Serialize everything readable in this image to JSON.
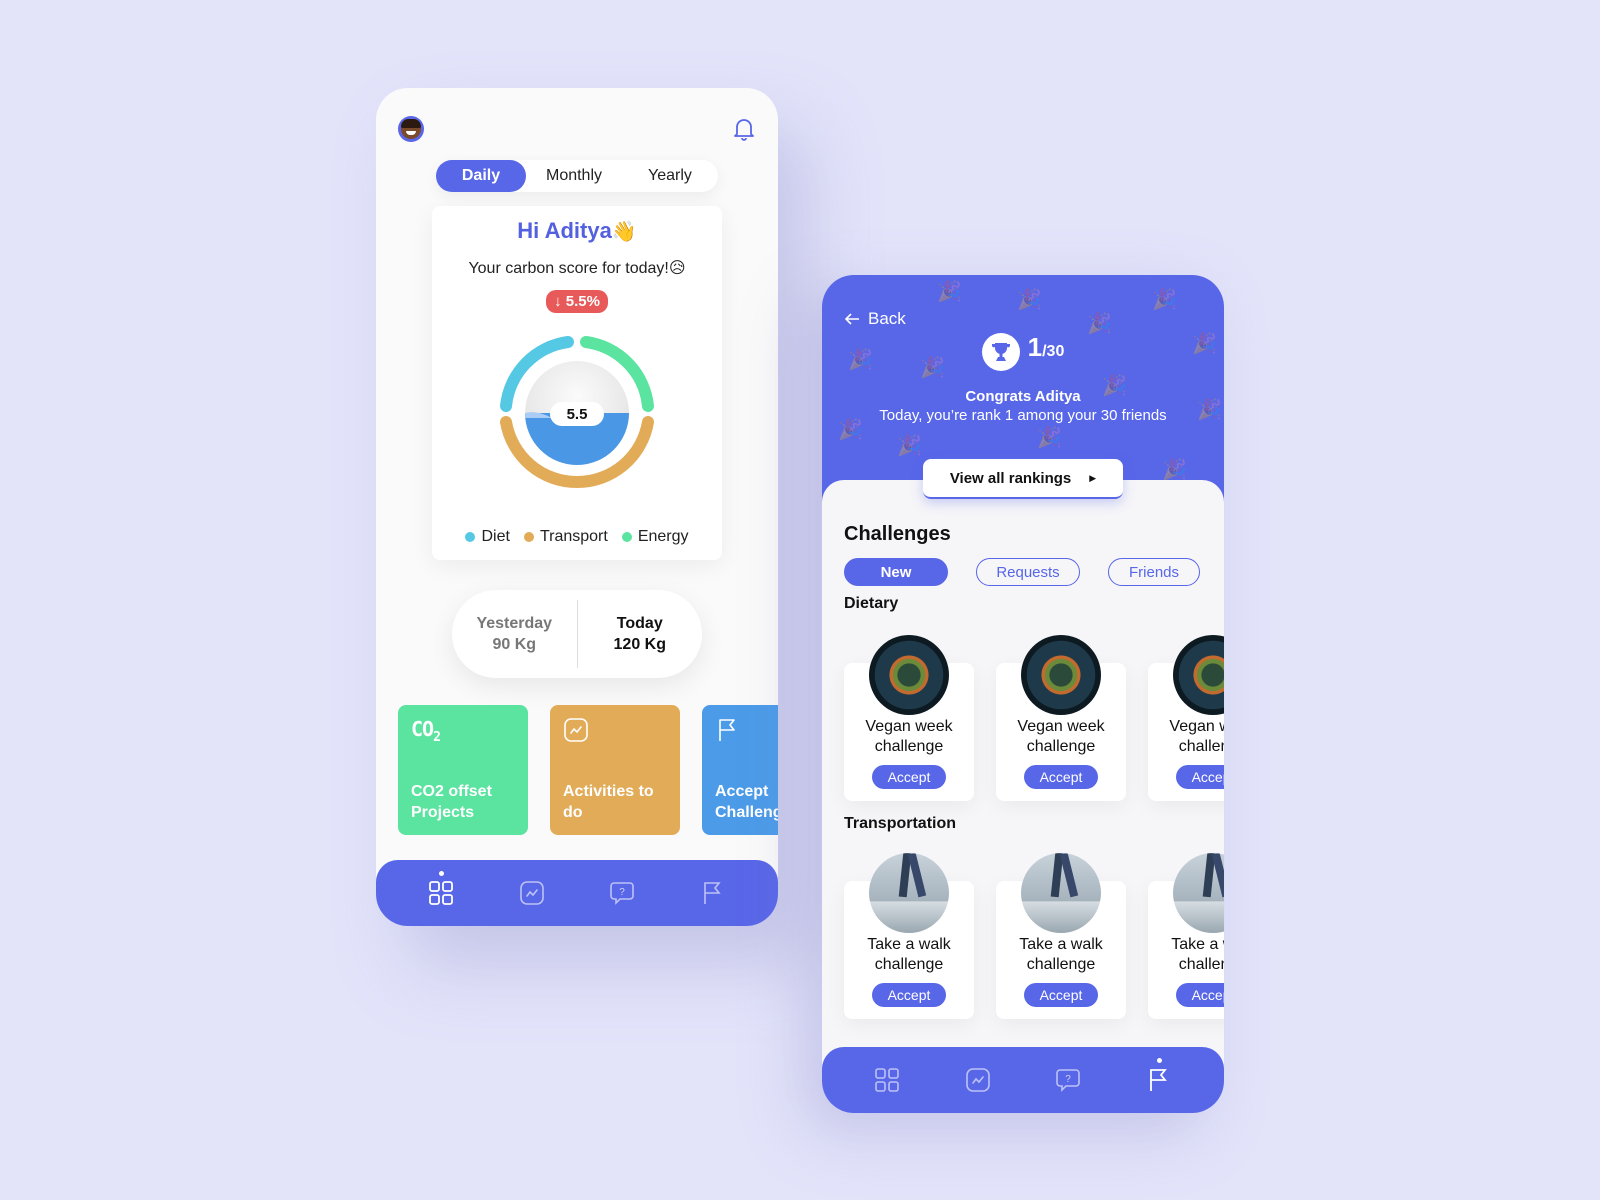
{
  "dashboard": {
    "avatar_label": "user-avatar",
    "period_tabs": [
      {
        "label": "Daily",
        "active": true
      },
      {
        "label": "Monthly",
        "active": false
      },
      {
        "label": "Yearly",
        "active": false
      }
    ],
    "greeting": "Hi Aditya",
    "greeting_emoji": "👋",
    "subtitle": "Your carbon score for today!😥",
    "change_badge": "↓ 5.5%",
    "score_value": "5.5",
    "score_fill_fraction": 0.5,
    "categories": [
      {
        "name": "Diet",
        "color": "#55c8e4"
      },
      {
        "name": "Transport",
        "color": "#e2ab57"
      },
      {
        "name": "Energy",
        "color": "#5be3a0"
      }
    ],
    "comparison": {
      "yesterday_label": "Yesterday",
      "yesterday_value": "90 Kg",
      "today_label": "Today",
      "today_value": "120 Kg"
    },
    "tiles": [
      {
        "icon": "CO2",
        "label1": "CO2 offset",
        "label2": "Projects",
        "color": "#5be3a0"
      },
      {
        "icon": "chart-icon",
        "label1": "Activities to",
        "label2": "do",
        "color": "#e2ab57"
      },
      {
        "icon": "flag-icon",
        "label1": "Accept",
        "label2": "Challenges",
        "color": "#4b9be8"
      }
    ],
    "nav_active": "dashboard"
  },
  "challenges_screen": {
    "back_label": "Back",
    "rank": "1",
    "rank_total": "/30",
    "congrats_title": "Congrats Aditya",
    "congrats_text": "Today, you’re rank 1 among your 30 friends",
    "view_all_label": "View all rankings",
    "heading": "Challenges",
    "filters": [
      {
        "label": "New",
        "active": true
      },
      {
        "label": "Requests",
        "active": false
      },
      {
        "label": "Friends",
        "active": false
      }
    ],
    "sections": [
      {
        "title": "Dietary",
        "cards": [
          {
            "title1": "Vegan week",
            "title2": "challenge",
            "button": "Accept"
          },
          {
            "title1": "Vegan week",
            "title2": "challenge",
            "button": "Accept"
          },
          {
            "title1": "Vegan week",
            "title2": "challenge",
            "button": "Accept"
          }
        ]
      },
      {
        "title": "Transportation",
        "cards": [
          {
            "title1": "Take a walk",
            "title2": "challenge",
            "button": "Accept"
          },
          {
            "title1": "Take a walk",
            "title2": "challenge",
            "button": "Accept"
          },
          {
            "title1": "Take a walk",
            "title2": "challenge",
            "button": "Accept"
          }
        ]
      }
    ],
    "nav_active": "challenges"
  },
  "colors": {
    "primary": "#5866e8",
    "background": "#e3e4fa",
    "alert": "#e85a5a",
    "water": "#4a97e6"
  }
}
